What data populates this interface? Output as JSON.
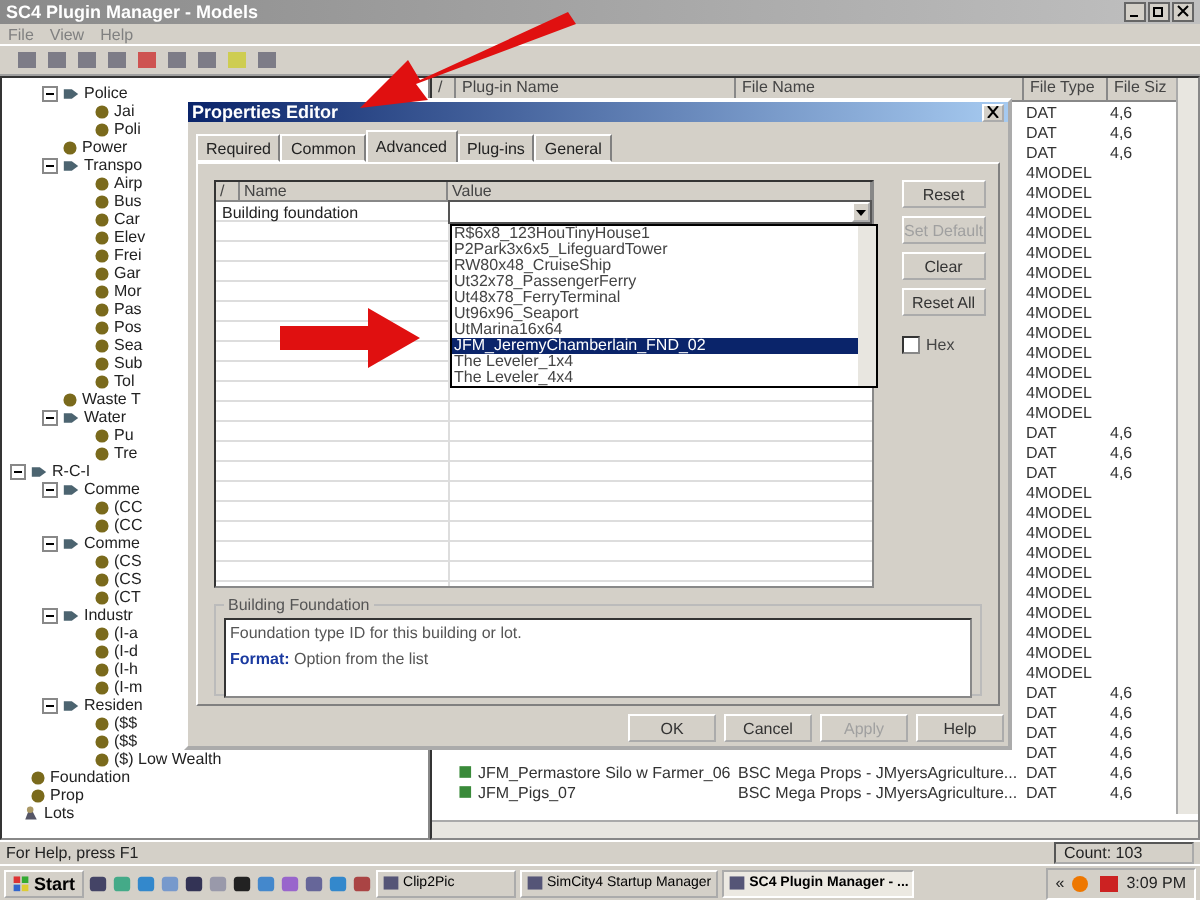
{
  "window": {
    "title": "SC4 Plugin Manager - Models"
  },
  "menu": [
    "File",
    "View",
    "Help"
  ],
  "tree": [
    {
      "children": [
        {
          "children": [
            {
              "label": "Police",
              "kind": "group",
              "expanded": true,
              "children": [
                {
                  "label": "Jai",
                  "kind": "item"
                },
                {
                  "label": "Poli",
                  "kind": "item"
                }
              ]
            },
            {
              "label": "Power",
              "kind": "item"
            },
            {
              "label": "Transpo",
              "kind": "group",
              "expanded": true,
              "children": [
                {
                  "label": "Airp",
                  "kind": "item"
                },
                {
                  "label": "Bus",
                  "kind": "item"
                },
                {
                  "label": "Car",
                  "kind": "item"
                },
                {
                  "label": "Elev",
                  "kind": "item"
                },
                {
                  "label": "Frei",
                  "kind": "item"
                },
                {
                  "label": "Gar",
                  "kind": "item"
                },
                {
                  "label": "Mor",
                  "kind": "item"
                },
                {
                  "label": "Pas",
                  "kind": "item"
                },
                {
                  "label": "Pos",
                  "kind": "item"
                },
                {
                  "label": "Sea",
                  "kind": "item"
                },
                {
                  "label": "Sub",
                  "kind": "item"
                },
                {
                  "label": "Tol",
                  "kind": "item"
                }
              ]
            },
            {
              "label": "Waste T",
              "kind": "item"
            },
            {
              "label": "Water",
              "kind": "group",
              "expanded": true,
              "children": [
                {
                  "label": "Pu",
                  "kind": "item"
                },
                {
                  "label": "Tre",
                  "kind": "item"
                }
              ]
            }
          ]
        },
        {
          "label": "R-C-I",
          "kind": "group",
          "expanded": true,
          "children": [
            {
              "label": "Comme",
              "kind": "group",
              "expanded": true,
              "children": [
                {
                  "label": "(CC",
                  "kind": "item"
                },
                {
                  "label": "(CC",
                  "kind": "item"
                }
              ]
            },
            {
              "label": "Comme",
              "kind": "group",
              "expanded": true,
              "children": [
                {
                  "label": "(CS",
                  "kind": "item"
                },
                {
                  "label": "(CS",
                  "kind": "item"
                },
                {
                  "label": "(CT",
                  "kind": "item"
                }
              ]
            },
            {
              "label": "Industr",
              "kind": "group",
              "expanded": true,
              "children": [
                {
                  "label": "(I-a",
                  "kind": "item"
                },
                {
                  "label": "(I-d",
                  "kind": "item"
                },
                {
                  "label": "(I-h",
                  "kind": "item"
                },
                {
                  "label": "(I-m",
                  "kind": "item"
                }
              ]
            },
            {
              "label": "Residen",
              "kind": "group",
              "expanded": true,
              "children": [
                {
                  "label": "($$",
                  "kind": "item"
                },
                {
                  "label": "($$",
                  "kind": "item"
                },
                {
                  "label": "($) Low Wealth",
                  "kind": "item"
                }
              ]
            }
          ]
        },
        {
          "label": "Foundation",
          "kind": "item"
        },
        {
          "label": "Prop",
          "kind": "item"
        }
      ]
    },
    {
      "label": "Lots",
      "kind": "lot"
    }
  ],
  "list": {
    "columns": [
      "/",
      "Plug-in Name",
      "File Name",
      "File Type",
      "File Siz"
    ],
    "rows": [
      {
        "file_type": "DAT",
        "file_size": "4,6"
      },
      {
        "file_type": "DAT",
        "file_size": "4,6"
      },
      {
        "file_type": "DAT",
        "file_size": "4,6"
      },
      {
        "file_type": "4MODEL"
      },
      {
        "file_type": "4MODEL"
      },
      {
        "file_type": "4MODEL"
      },
      {
        "file_type": "4MODEL"
      },
      {
        "file_type": "4MODEL"
      },
      {
        "file_type": "4MODEL"
      },
      {
        "file_type": "4MODEL"
      },
      {
        "file_type": "4MODEL"
      },
      {
        "file_type": "4MODEL"
      },
      {
        "file_type": "4MODEL"
      },
      {
        "file_type": "4MODEL"
      },
      {
        "file_type": "4MODEL"
      },
      {
        "file_type": "4MODEL"
      },
      {
        "file_type": "DAT",
        "file_size": "4,6"
      },
      {
        "file_type": "DAT",
        "file_size": "4,6"
      },
      {
        "file_type": "DAT",
        "file_size": "4,6"
      },
      {
        "file_type": "4MODEL"
      },
      {
        "file_type": "4MODEL"
      },
      {
        "file_type": "4MODEL"
      },
      {
        "file_type": "4MODEL"
      },
      {
        "file_type": "4MODEL"
      },
      {
        "file_type": "4MODEL"
      },
      {
        "file_type": "4MODEL"
      },
      {
        "file_type": "4MODEL"
      },
      {
        "file_type": "4MODEL"
      },
      {
        "file_type": "4MODEL"
      },
      {
        "file_type": "DAT",
        "file_size": "4,6"
      },
      {
        "file_type": "DAT",
        "file_size": "4,6"
      },
      {
        "file_type": "DAT",
        "file_size": "4,6"
      },
      {
        "file_type": "DAT",
        "file_size": "4,6"
      },
      {
        "name": "JFM_Permastore Silo w Farmer_06",
        "file_name": "BSC Mega Props - JMyersAgriculture...",
        "file_type": "DAT",
        "file_size": "4,6"
      },
      {
        "name": "JFM_Pigs_07",
        "file_name": "BSC Mega Props - JMyersAgriculture...",
        "file_type": "DAT",
        "file_size": "4,6"
      }
    ]
  },
  "dialog": {
    "title": "Properties Editor",
    "tabs": [
      {
        "label": "Required",
        "selected": false
      },
      {
        "label": "Common",
        "selected": false
      },
      {
        "label": "Advanced",
        "selected": true
      },
      {
        "label": "Plug-ins",
        "selected": false
      },
      {
        "label": "General",
        "selected": false
      }
    ],
    "grid": {
      "columns": [
        "/",
        "Name",
        "Value"
      ],
      "rows": [
        {
          "name": "Building foundation",
          "options": [
            {
              "label": "R$6x8_123HouTinyHouse1",
              "selected": false
            },
            {
              "label": "P2Park3x6x5_LifeguardTower",
              "selected": false
            },
            {
              "label": "RW80x48_CruiseShip",
              "selected": false
            },
            {
              "label": "Ut32x78_PassengerFerry",
              "selected": false
            },
            {
              "label": "Ut48x78_FerryTerminal",
              "selected": false
            },
            {
              "label": "Ut96x96_Seaport",
              "selected": false
            },
            {
              "label": "UtMarina16x64",
              "selected": false
            },
            {
              "label": "JFM_JeremyChamberlain_FND_02",
              "selected": true
            },
            {
              "label": "The Leveler_1x4",
              "selected": false
            },
            {
              "label": "The Leveler_4x4",
              "selected": false
            }
          ]
        }
      ]
    },
    "side_buttons": [
      {
        "label": "Reset",
        "disabled": false
      },
      {
        "label": "Set Default",
        "disabled": true
      },
      {
        "label": "Clear",
        "disabled": false
      },
      {
        "label": "Reset All",
        "disabled": false
      }
    ],
    "hex": {
      "label": "Hex",
      "checked": false
    },
    "description": {
      "title": "Building Foundation",
      "text": "Foundation type ID for this building or lot.",
      "format": "**Format:** Option from the list"
    },
    "buttons": [
      {
        "label": "OK",
        "disabled": false
      },
      {
        "label": "Cancel",
        "disabled": false
      },
      {
        "label": "Apply",
        "disabled": true
      },
      {
        "label": "Help",
        "disabled": false
      }
    ]
  },
  "status_bar": {
    "help": "For Help, press F1",
    "count": "Count: 103"
  },
  "taskbar": {
    "start": "Start",
    "tasks": [
      {
        "label": "Clip2Pic",
        "active": false
      },
      {
        "label": "SimCity4 Startup Manager",
        "active": false
      },
      {
        "label": "SC4 Plugin Manager - ...",
        "active": true
      }
    ],
    "tray_toggle": "«",
    "clock": "3:09 PM"
  }
}
